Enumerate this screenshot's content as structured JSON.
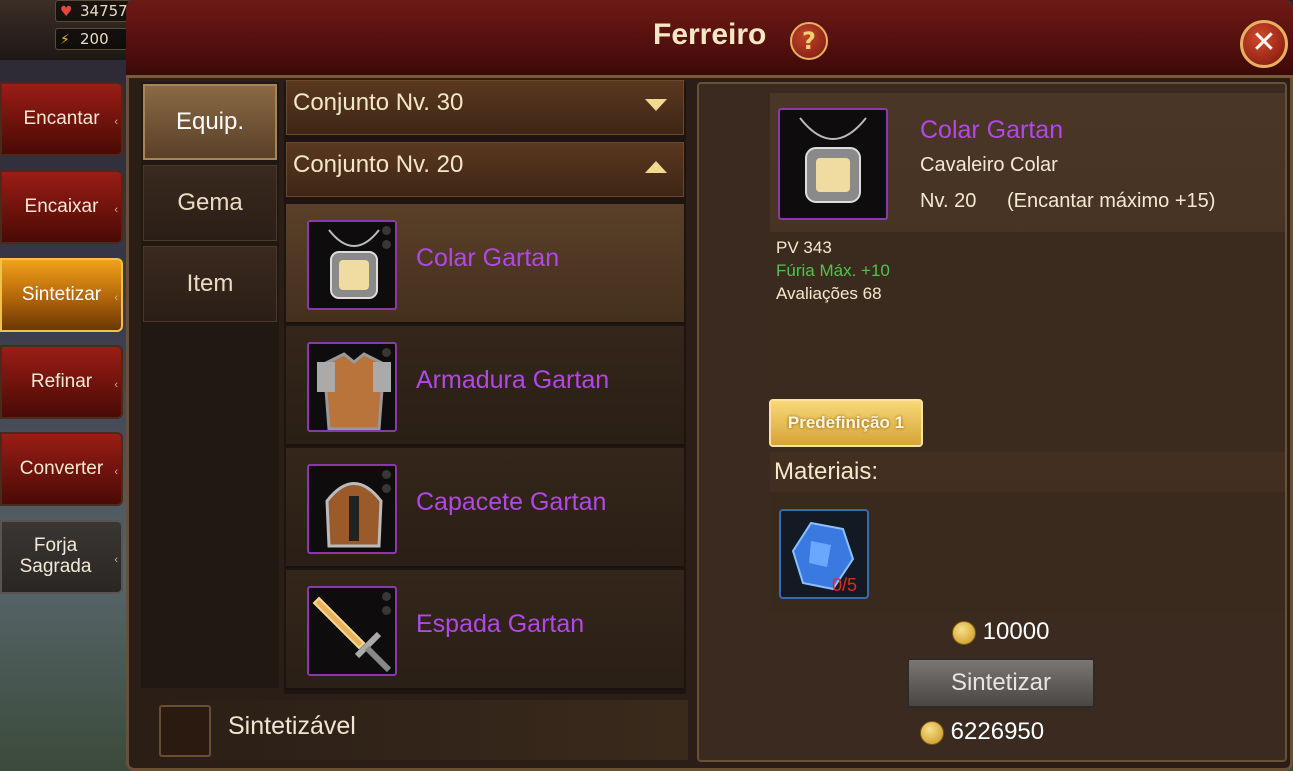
{
  "resources": {
    "health": "34757",
    "energy": "200"
  },
  "window": {
    "title": "Ferreiro",
    "help_label": "?",
    "close_label": "✕"
  },
  "side_menu": [
    {
      "label": "Encantar"
    },
    {
      "label": "Encaixar"
    },
    {
      "label": "Sintetizar"
    },
    {
      "label": "Refinar"
    },
    {
      "label": "Converter"
    },
    {
      "label": "Forja Sagrada"
    }
  ],
  "tabs": [
    {
      "label": "Equip."
    },
    {
      "label": "Gema"
    },
    {
      "label": "Item"
    }
  ],
  "groups": [
    {
      "label": "Conjunto Nv. 30",
      "state": "collapsed"
    },
    {
      "label": "Conjunto Nv. 20",
      "state": "expanded"
    }
  ],
  "items": [
    {
      "name": "Colar Gartan",
      "icon": "necklace-icon",
      "rarity_color": "#b347e8"
    },
    {
      "name": "Armadura Gartan",
      "icon": "armor-icon",
      "rarity_color": "#b347e8"
    },
    {
      "name": "Capacete Gartan",
      "icon": "helmet-icon",
      "rarity_color": "#b347e8"
    },
    {
      "name": "Espada Gartan",
      "icon": "sword-icon",
      "rarity_color": "#b347e8"
    }
  ],
  "filter": {
    "label": "Sintetizável"
  },
  "detail": {
    "name": "Colar Gartan",
    "type": "Cavaleiro Colar",
    "level": "Nv. 20",
    "max_enchant": "(Encantar máximo +15)",
    "stats": [
      {
        "label": "PV",
        "value": "343",
        "color": "#f6e8cc"
      },
      {
        "label": "Fúria Máx.",
        "value": "+10",
        "color": "#4cc64a"
      },
      {
        "label": "Avaliações",
        "value": "68",
        "color": "#f6e8cc"
      }
    ],
    "preset_label": "Predefinição 1",
    "materials_label": "Materiais:",
    "material": {
      "icon": "crystal-icon",
      "count": "0/5"
    },
    "cost": "10000",
    "synth_label": "Sintetizar",
    "gold": "6226950"
  }
}
